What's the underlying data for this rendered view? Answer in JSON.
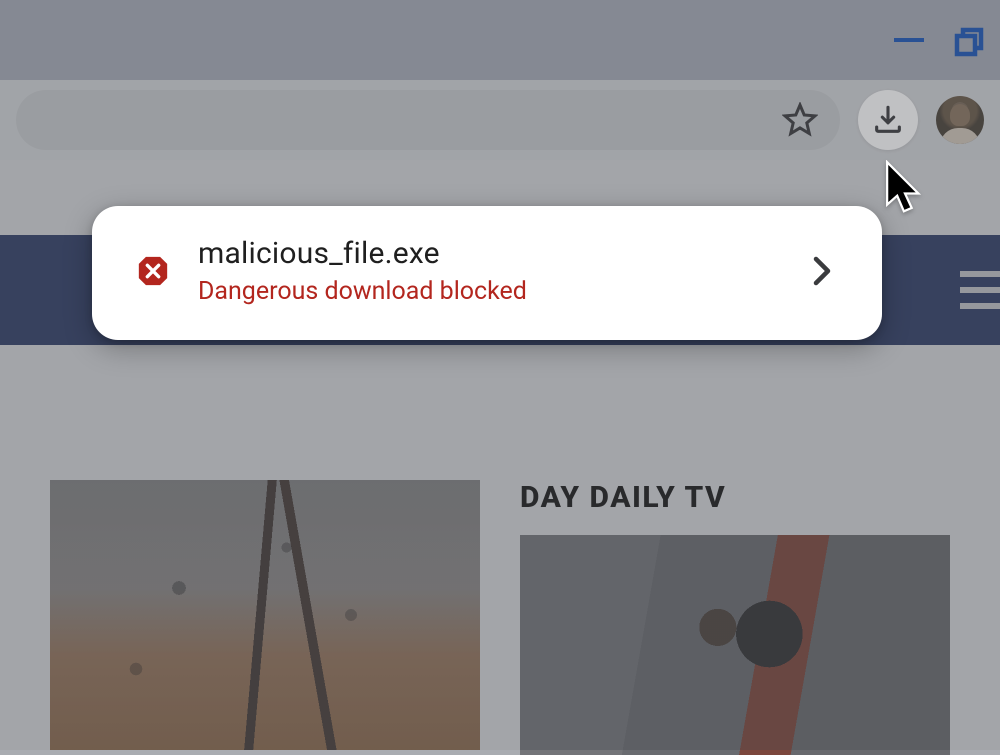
{
  "window": {
    "minimize_name": "minimize",
    "restore_name": "restore"
  },
  "toolbar": {
    "bookmark_name": "bookmark-star",
    "downloads_name": "downloads",
    "profile_name": "profile-avatar"
  },
  "downloads_popover": {
    "file_name": "malicious_file.exe",
    "status_text": "Dangerous download blocked",
    "status_color": "#b3261e",
    "badge_color": "#b3261e"
  },
  "page": {
    "nav_menu_name": "site-menu",
    "headline": "DAY DAILY TV"
  }
}
